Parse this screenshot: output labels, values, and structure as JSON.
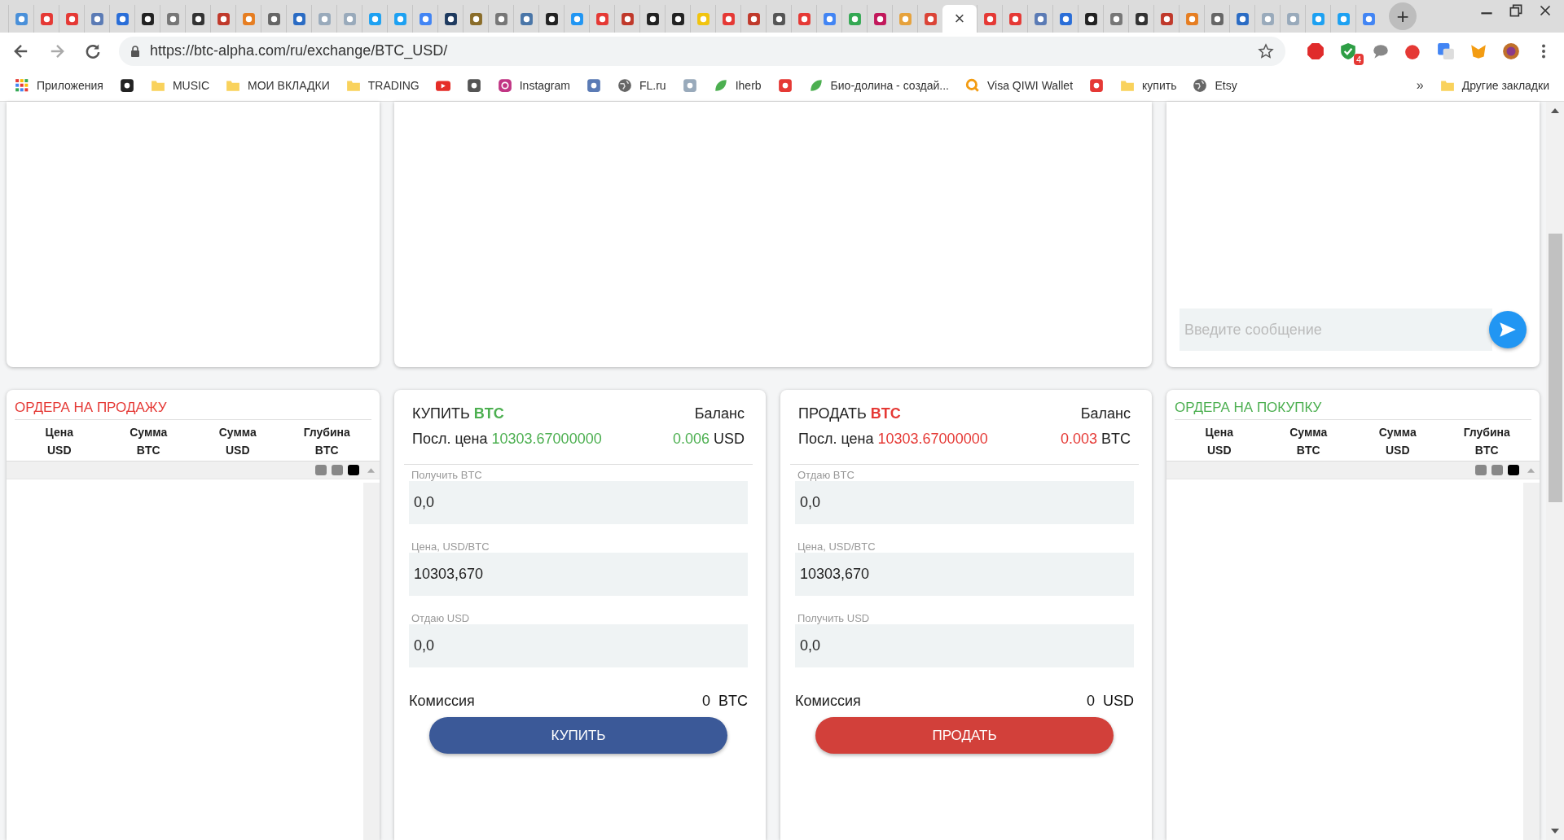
{
  "browser": {
    "tabs": [
      {
        "selected": false
      },
      {
        "selected": false
      },
      {
        "selected": false
      },
      {
        "selected": false
      },
      {
        "selected": false
      },
      {
        "selected": false
      },
      {
        "selected": false
      },
      {
        "selected": false
      },
      {
        "selected": false
      },
      {
        "selected": false
      },
      {
        "selected": false
      },
      {
        "selected": false
      },
      {
        "selected": false
      },
      {
        "selected": false
      },
      {
        "selected": false
      },
      {
        "selected": false
      },
      {
        "selected": false
      },
      {
        "selected": false
      },
      {
        "selected": false
      },
      {
        "selected": false
      },
      {
        "selected": false
      },
      {
        "selected": false
      },
      {
        "selected": false
      },
      {
        "selected": false
      },
      {
        "selected": false
      },
      {
        "selected": false
      },
      {
        "selected": false
      },
      {
        "selected": false
      },
      {
        "selected": false
      },
      {
        "selected": false
      },
      {
        "selected": false
      },
      {
        "selected": false
      },
      {
        "selected": false
      },
      {
        "selected": false
      },
      {
        "selected": false
      },
      {
        "selected": false
      },
      {
        "selected": false
      },
      {
        "selected": true,
        "close": "×"
      },
      {
        "selected": false
      },
      {
        "selected": false
      },
      {
        "selected": false
      },
      {
        "selected": false
      },
      {
        "selected": false
      },
      {
        "selected": false
      },
      {
        "selected": false
      },
      {
        "selected": false
      },
      {
        "selected": false
      },
      {
        "selected": false
      },
      {
        "selected": false
      },
      {
        "selected": false
      },
      {
        "selected": false
      },
      {
        "selected": false
      },
      {
        "selected": false
      },
      {
        "selected": false
      }
    ],
    "new_tab": "+",
    "url": "https://btc-alpha.com/ru/exchange/BTC_USD/",
    "extension_badge": "4",
    "bookmarks": [
      {
        "kind": "apps",
        "label": "Приложения"
      },
      {
        "kind": "site"
      },
      {
        "kind": "folder",
        "label": "MUSIC"
      },
      {
        "kind": "folder",
        "label": "МОИ ВКЛАДКИ"
      },
      {
        "kind": "folder",
        "label": "TRADING"
      },
      {
        "kind": "video"
      },
      {
        "kind": "site"
      },
      {
        "kind": "camera",
        "label": "Instagram"
      },
      {
        "kind": "site"
      },
      {
        "kind": "globe",
        "label": "FL.ru"
      },
      {
        "kind": "site"
      },
      {
        "kind": "leaf",
        "label": "Iherb"
      },
      {
        "kind": "site"
      },
      {
        "kind": "leaf",
        "label": "Био-долина - создай..."
      },
      {
        "kind": "search",
        "label": "Visa QIWI Wallet"
      },
      {
        "kind": "site"
      },
      {
        "kind": "folder",
        "label": "купить"
      },
      {
        "kind": "globe",
        "label": "Etsy"
      }
    ],
    "more": "»",
    "other_bookmarks": "Другие закладки"
  },
  "chat": {
    "placeholder": "Введите сообщение"
  },
  "order_books": [
    {
      "color": "#e53935",
      "title": "ОРДЕРА НА ПРОДАЖУ",
      "columns": [
        {
          "name": "Цена",
          "unit": "USD"
        },
        {
          "name": "Сумма",
          "unit": "BTC"
        },
        {
          "name": "Сумма",
          "unit": "USD"
        },
        {
          "name": "Глубина",
          "unit": "BTC"
        }
      ]
    },
    {
      "color": "#4caf50",
      "title": "ОРДЕРА НА ПОКУПКУ",
      "columns": [
        {
          "name": "Цена",
          "unit": "USD"
        },
        {
          "name": "Сумма",
          "unit": "BTC"
        },
        {
          "name": "Сумма",
          "unit": "USD"
        },
        {
          "name": "Глубина",
          "unit": "BTC"
        }
      ]
    }
  ],
  "trade_forms": [
    {
      "color": "#4caf50",
      "action": "КУПИТЬ",
      "currency": "BTC",
      "balance_label": "Баланс",
      "last_price_label": "Посл. цена",
      "last_price": "10303.67000000",
      "balance_amount": "0.006",
      "balance_currency": "USD",
      "fields": [
        {
          "label": "Получить BTC",
          "value": "0,0"
        },
        {
          "label": "Цена, USD/BTC",
          "value": "10303,670"
        },
        {
          "label": "Отдаю USD",
          "value": "0,0"
        }
      ],
      "commission_label": "Комиссия",
      "commission_value": "0",
      "commission_currency": "BTC",
      "button": {
        "label": "КУПИТЬ",
        "color": "#3b5998"
      }
    },
    {
      "color": "#e53935",
      "action": "ПРОДАТЬ",
      "currency": "BTC",
      "balance_label": "Баланс",
      "last_price_label": "Посл. цена",
      "last_price": "10303.67000000",
      "balance_amount": "0.003",
      "balance_currency": "BTC",
      "fields": [
        {
          "label": "Отдаю BTC",
          "value": "0,0"
        },
        {
          "label": "Цена, USD/BTC",
          "value": "10303,670"
        },
        {
          "label": "Получить USD",
          "value": "0,0"
        }
      ],
      "commission_label": "Комиссия",
      "commission_value": "0",
      "commission_currency": "USD",
      "button": {
        "label": "ПРОДАТЬ",
        "color": "#d2403a"
      }
    }
  ]
}
